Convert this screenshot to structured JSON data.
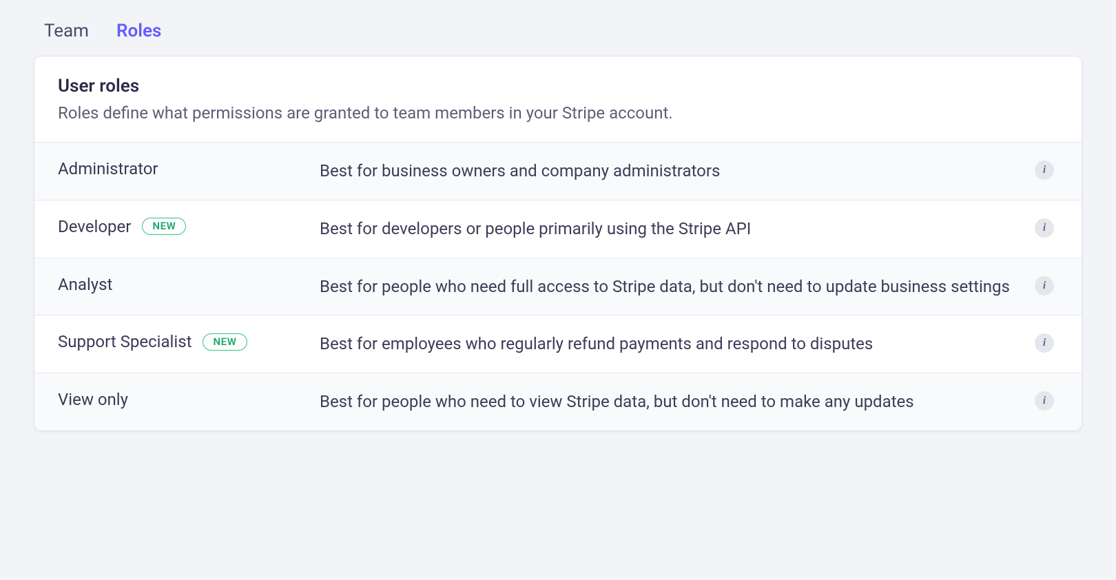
{
  "tabs": [
    {
      "label": "Team",
      "active": false
    },
    {
      "label": "Roles",
      "active": true
    }
  ],
  "header": {
    "title": "User roles",
    "subtitle": "Roles define what permissions are granted to team members in your Stripe account."
  },
  "badge_new": "NEW",
  "roles": [
    {
      "name": "Administrator",
      "badge": null,
      "description": "Best for business owners and company administrators",
      "shaded": true
    },
    {
      "name": "Developer",
      "badge": "NEW",
      "description": "Best for developers or people primarily using the Stripe API",
      "shaded": false
    },
    {
      "name": "Analyst",
      "badge": null,
      "description": "Best for people who need full access to Stripe data, but don't need to update business settings",
      "shaded": true
    },
    {
      "name": "Support Specialist",
      "badge": "NEW",
      "description": "Best for employees who regularly refund payments and respond to disputes",
      "shaded": false
    },
    {
      "name": "View only",
      "badge": null,
      "description": "Best for people who need to view Stripe data, but don't need to make any updates",
      "shaded": true
    }
  ]
}
